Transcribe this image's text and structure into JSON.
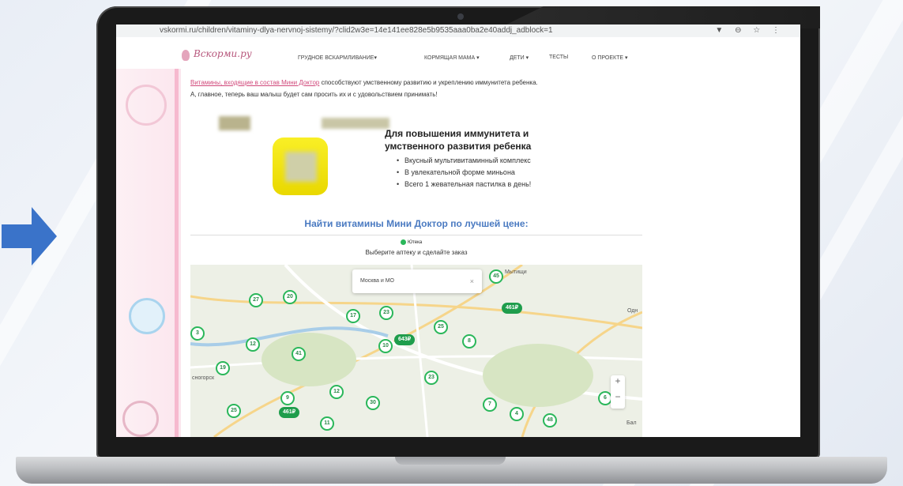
{
  "browser": {
    "url": "vskormi.ru/children/vitaminy-dlya-nervnoj-sistemy/?clid2w3e=14e141ee828e5b9535aaa0ba2e40addj_adblock=1",
    "nav_icons": "▼ ⊖ ☆ ⋮"
  },
  "site": {
    "logo": "Вскорми.ру",
    "nav": [
      "ГРУДНОЕ ВСКАРМЛИВАНИЕ▾",
      "КОРМЯЩАЯ МАМА ▾",
      "ДЕТИ ▾",
      "ТЕСТЫ",
      "О ПРОЕКТЕ ▾"
    ]
  },
  "article": {
    "intro_link": "Витамины, входящие в состав Мини Доктор",
    "intro_rest": " способствуют умственному развитию и укреплению иммунитета ребенка.",
    "intro_line2": "А, главное, теперь ваш малыш будет сам просить их и с удовольствием принимать!"
  },
  "promo": {
    "title": "Для повышения иммунитета и умственного развития ребенка",
    "bullets": [
      "Вкусный мультивитаминный комплекс",
      "В увлекательной форме миньона",
      "Всего 1 жевательная пастилка в день!"
    ]
  },
  "finder": {
    "heading": "Найти витамины Мини Доктор по лучшей цене:",
    "provider": "Ютека",
    "subheading": "Выберите аптеку и сделайте заказ"
  },
  "map": {
    "search_value": "Москва и МО",
    "clear_icon": "×",
    "zoom_in": "+",
    "zoom_out": "−",
    "labels": [
      "Мытищи",
      "сногорск",
      "Бал",
      "Одн"
    ],
    "pins": [
      "45",
      "27",
      "20",
      "17",
      "23",
      "25",
      "3",
      "12",
      "10",
      "41",
      "8",
      "19",
      "23",
      "9",
      "12",
      "30",
      "7",
      "6",
      "25",
      "11",
      "4",
      "48"
    ],
    "prices": [
      "461₽",
      "643₽",
      "461₽"
    ]
  },
  "colors": {
    "brand_pink": "#d1497b",
    "heading_blue": "#4a7ac1",
    "pharmacy_green": "#2ab75a",
    "arrow_blue": "#3a73c9"
  }
}
